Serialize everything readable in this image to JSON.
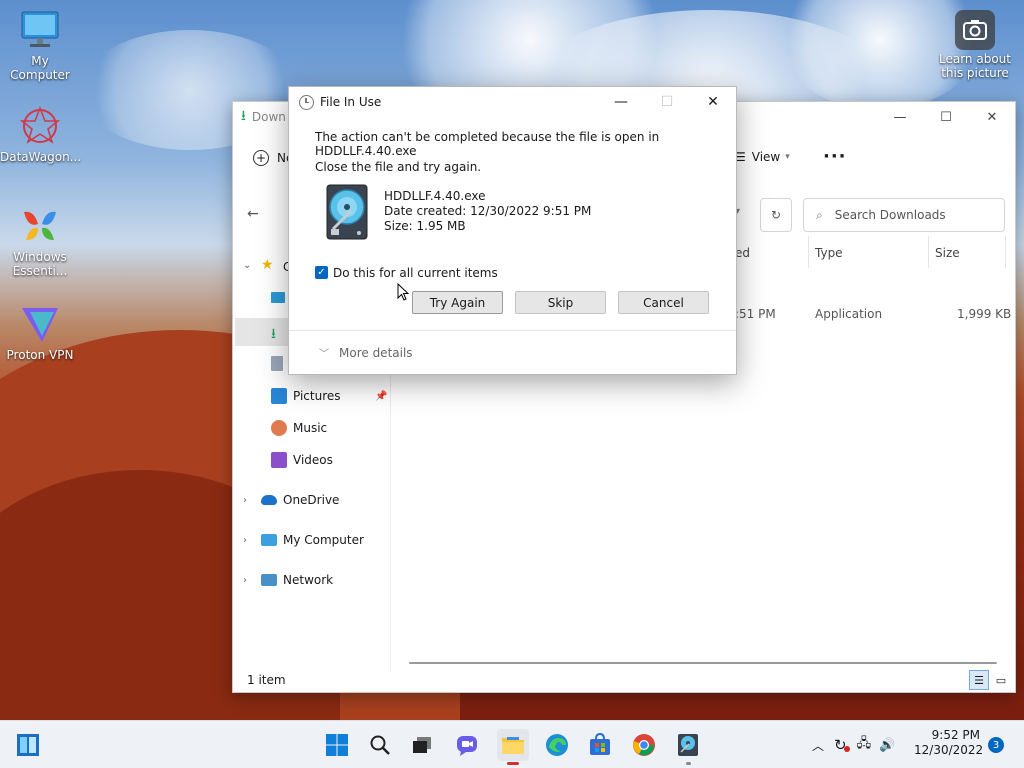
{
  "desktop": {
    "icons": [
      {
        "label": "My Computer",
        "icon": "monitor-icon"
      },
      {
        "label": "DataWagon...",
        "icon": "datawagon-icon"
      },
      {
        "label": "Windows Essenti...",
        "icon": "windows-essentials-icon"
      },
      {
        "label": "Proton VPN",
        "icon": "proton-vpn-icon"
      }
    ],
    "learn_about": {
      "label": "Learn about this picture",
      "icon": "camera-icon"
    }
  },
  "explorer": {
    "title": "Down",
    "toolbar": {
      "new_label": "Ne",
      "view_label": "View",
      "more": "···"
    },
    "search_placeholder": "Search Downloads",
    "columns": {
      "date_partial": "ed",
      "type": "Type",
      "size": "Size"
    },
    "row": {
      "date_partial": ":51 PM",
      "type": "Application",
      "size": "1,999 KB"
    },
    "sidebar": {
      "quick_access_partial": "C",
      "items": [
        {
          "label": "Pictures",
          "icon": "pictures-icon",
          "pinned": true
        },
        {
          "label": "Music",
          "icon": "music-icon"
        },
        {
          "label": "Videos",
          "icon": "videos-icon"
        },
        {
          "label": "OneDrive",
          "icon": "onedrive-icon"
        },
        {
          "label": "My Computer",
          "icon": "computer-icon"
        },
        {
          "label": "Network",
          "icon": "network-icon"
        }
      ]
    },
    "status": "1 item"
  },
  "dialog": {
    "title": "File In Use",
    "message": "The action can't be completed because the file is open in HDDLLF.4.40.exe",
    "instruction": "Close the file and try again.",
    "file": {
      "name": "HDDLLF.4.40.exe",
      "date_created": "Date created: 12/30/2022 9:51 PM",
      "size": "Size: 1.95 MB"
    },
    "checkbox_label": "Do this for all current items",
    "checkbox_checked": true,
    "buttons": {
      "try_again": "Try Again",
      "skip": "Skip",
      "cancel": "Cancel"
    },
    "more_details": "More details"
  },
  "taskbar": {
    "time": "9:52 PM",
    "date": "12/30/2022",
    "notification_count": "3"
  },
  "colors": {
    "accent": "#0067c0",
    "taskbar_bg": "#eef1f6"
  }
}
